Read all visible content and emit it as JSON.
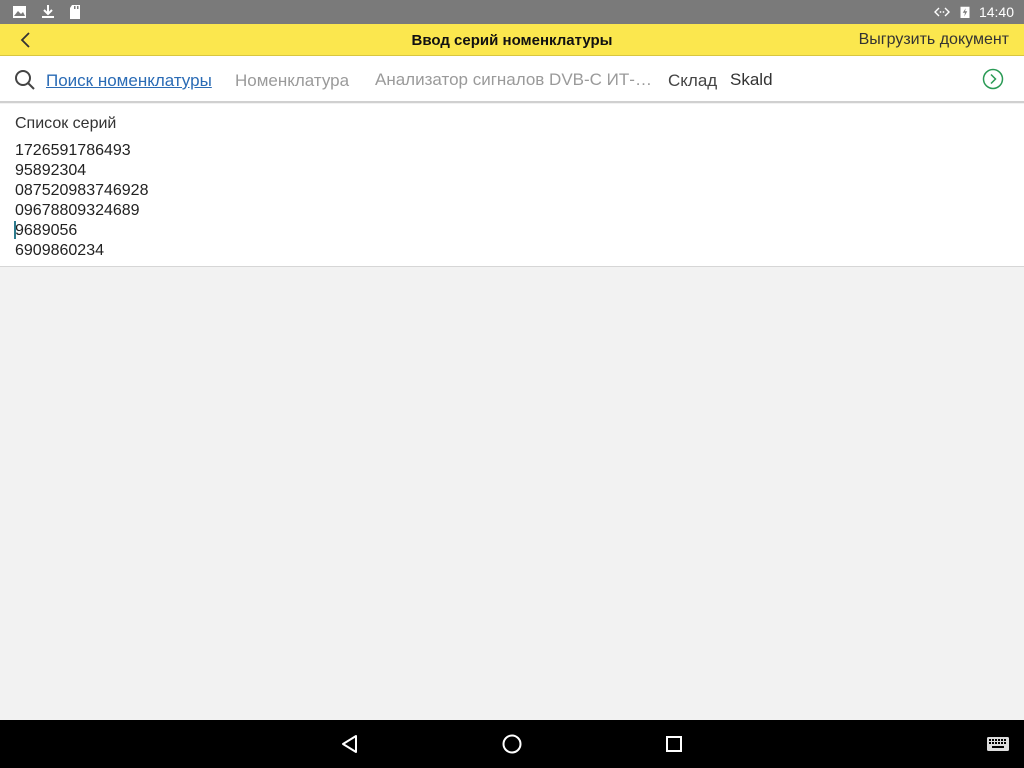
{
  "status_bar": {
    "time": "14:40",
    "icons_left": [
      "image-icon",
      "download-icon",
      "sd-card-icon"
    ],
    "icons_right": [
      "data-sync-icon",
      "battery-charging-icon"
    ]
  },
  "app_bar": {
    "title": "Ввод серий номенклатуры",
    "export_label": "Выгрузить документ",
    "accent_color": "#fbe74e"
  },
  "filters": {
    "search_link": "Поиск номенклатуры",
    "nomenclature_label": "Номенклатура",
    "nomenclature_value": "Анализатор сигналов DVB-C ИТ-0...",
    "warehouse_label": "Склад",
    "warehouse_value": "Skald"
  },
  "series": {
    "title": "Список серий",
    "items": [
      "1726591786493",
      "95892304",
      "087520983746928",
      "09678809324689",
      "9689056",
      "6909860234"
    ]
  },
  "nav_bar": {
    "icons": [
      "back-nav-icon",
      "home-icon",
      "recents-icon",
      "keyboard-icon"
    ]
  }
}
